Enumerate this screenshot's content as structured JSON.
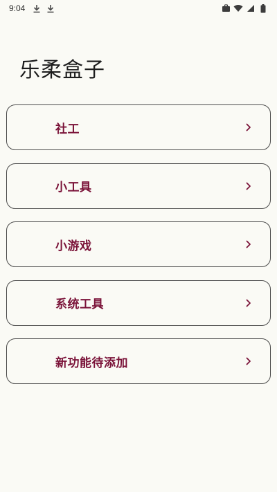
{
  "status_bar": {
    "time": "9:04",
    "left_icons": [
      "download-icon",
      "download-icon"
    ],
    "right_icons": [
      "briefcase-icon",
      "wifi-icon",
      "signal-icon",
      "battery-icon"
    ]
  },
  "app": {
    "title": "乐柔盒子"
  },
  "menu": {
    "items": [
      {
        "label": "社工"
      },
      {
        "label": "小工具"
      },
      {
        "label": "小游戏"
      },
      {
        "label": "系统工具"
      },
      {
        "label": "新功能待添加"
      }
    ]
  },
  "colors": {
    "background": "#fafaf5",
    "accent": "#7a1238",
    "border": "#4a4a4a",
    "title": "#1c1c1c"
  }
}
